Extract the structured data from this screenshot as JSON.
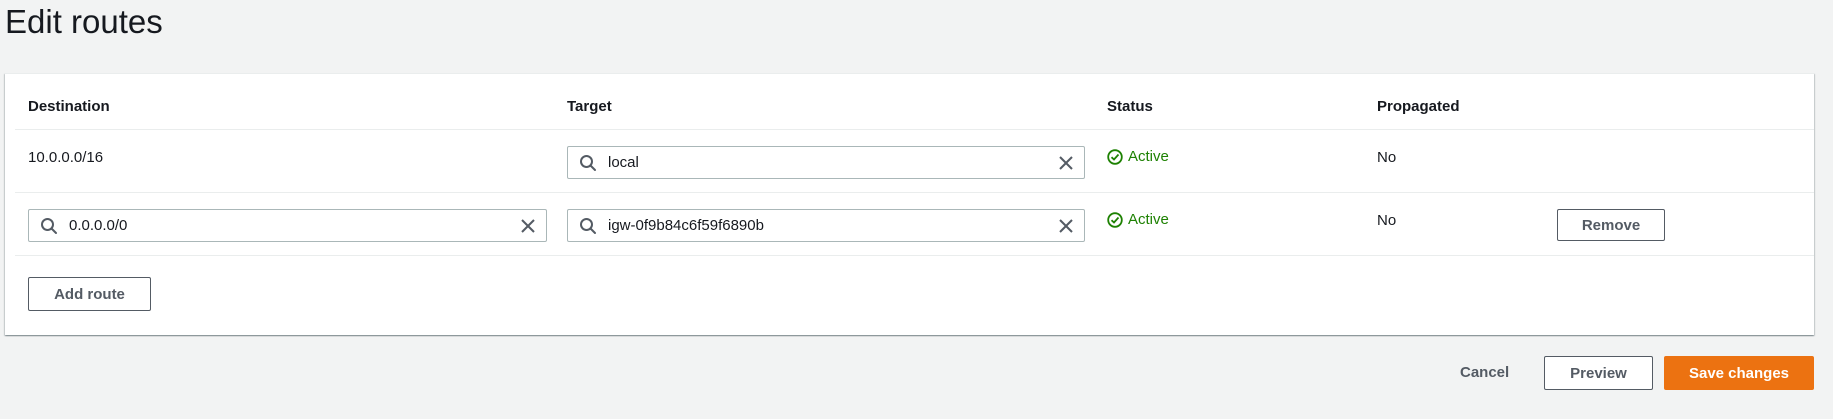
{
  "page": {
    "title": "Edit routes"
  },
  "table": {
    "columns": [
      "Destination",
      "Target",
      "Status",
      "Propagated"
    ],
    "rows": [
      {
        "destination": "10.0.0.0/16",
        "target": "local",
        "status": "Active",
        "propagated": "No"
      },
      {
        "destination": "0.0.0.0/0",
        "target": "igw-0f9b84c6f59f6890b",
        "status": "Active",
        "propagated": "No",
        "remove_label": "Remove"
      }
    ],
    "add_route_label": "Add route"
  },
  "footer": {
    "cancel_label": "Cancel",
    "preview_label": "Preview",
    "save_label": "Save changes"
  },
  "colors": {
    "accent": "#ec7211",
    "status_active": "#1d8102",
    "background": "#f2f3f3"
  }
}
